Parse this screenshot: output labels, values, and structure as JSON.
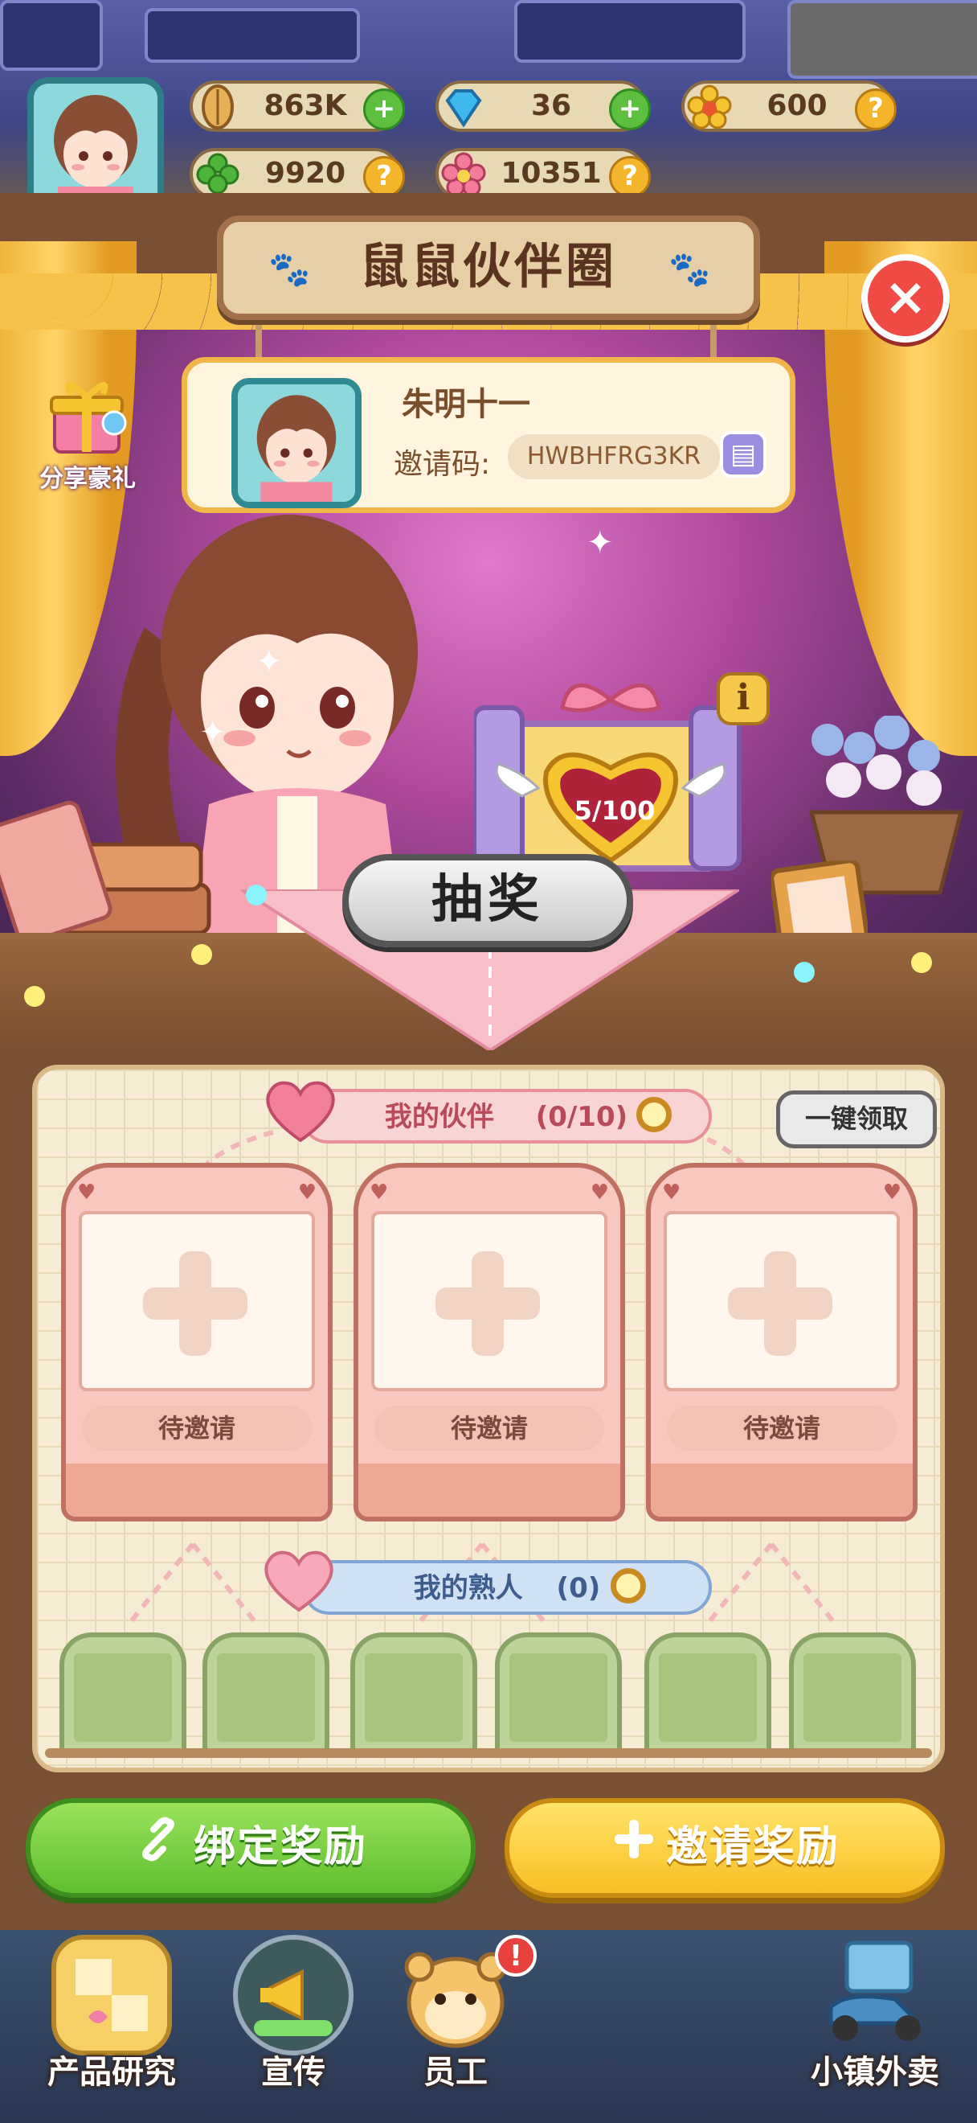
{
  "resources": [
    {
      "icon": "seed-icon",
      "value": "863K",
      "action": "+"
    },
    {
      "icon": "diamond-icon",
      "value": "36",
      "action": "+"
    },
    {
      "icon": "flower-coin-icon",
      "value": "600",
      "action": "?"
    },
    {
      "icon": "clover-icon",
      "value": "9920",
      "action": "?"
    },
    {
      "icon": "pink-flower-icon",
      "value": "10351",
      "action": "?"
    }
  ],
  "title": "鼠鼠伙伴圈",
  "close_label": "×",
  "share": {
    "label": "分享豪礼"
  },
  "player": {
    "name": "朱明十一",
    "invite_label": "邀请码:",
    "invite_code": "HWBHFRG3KR",
    "copy_icon": "copy-icon"
  },
  "chest": {
    "progress": "5/100",
    "info_label": "i"
  },
  "draw_label": "抽奖",
  "partners": {
    "label": "我的伙伴",
    "count": "(0/10)",
    "claim_all": "一键领取",
    "slots": [
      {
        "status": "待邀请"
      },
      {
        "status": "待邀请"
      },
      {
        "status": "待邀请"
      }
    ]
  },
  "acquaintances": {
    "label": "我的熟人",
    "count": "(0)",
    "slot_count": 6
  },
  "bind_reward": "绑定奖励",
  "invite_reward": "邀请奖励",
  "nav": [
    {
      "label": "产品研究",
      "badge": ""
    },
    {
      "label": "宣传",
      "badge": ""
    },
    {
      "label": "员工",
      "badge": "!"
    },
    {
      "label": "小镇外卖",
      "badge": ""
    }
  ],
  "colors": {
    "accent_green": "#5fbf2e",
    "accent_yellow": "#f9bf25",
    "close_red": "#f04a45",
    "stage_pink": "#b24a9e"
  }
}
